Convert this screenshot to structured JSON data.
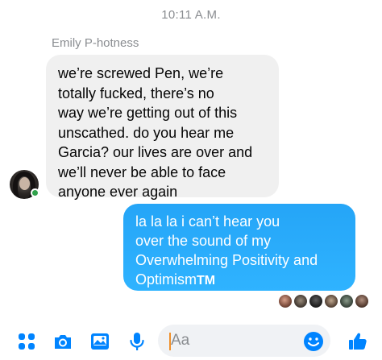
{
  "header": {
    "timestamp": "10:11 A.M."
  },
  "thread": {
    "incoming": {
      "sender": "Emily P-hotness",
      "lines": [
        "we’re screwed Pen, we’re",
        "totally fucked, there’s no",
        "way we’re getting out of this",
        "unscathed. do you hear me",
        "Garcia? our lives are over and",
        "we’ll never be able to face",
        "anyone ever again"
      ]
    },
    "outgoing": {
      "lines": [
        "la la la i can’t hear you",
        "over the sound of my",
        "Overwhelming Positivity and",
        "Optimism"
      ],
      "trademark": "TM"
    }
  },
  "colors": {
    "accent": "#0084ff",
    "outgoing_bubble": "#2aaefc",
    "incoming_bubble": "#f0f0f0",
    "online": "#31a24c"
  },
  "composer": {
    "placeholder": "Aa",
    "icons": [
      "apps-icon",
      "camera-icon",
      "gallery-icon",
      "microphone-icon",
      "emoji-icon",
      "like-icon"
    ]
  },
  "seen_by_count": 6
}
